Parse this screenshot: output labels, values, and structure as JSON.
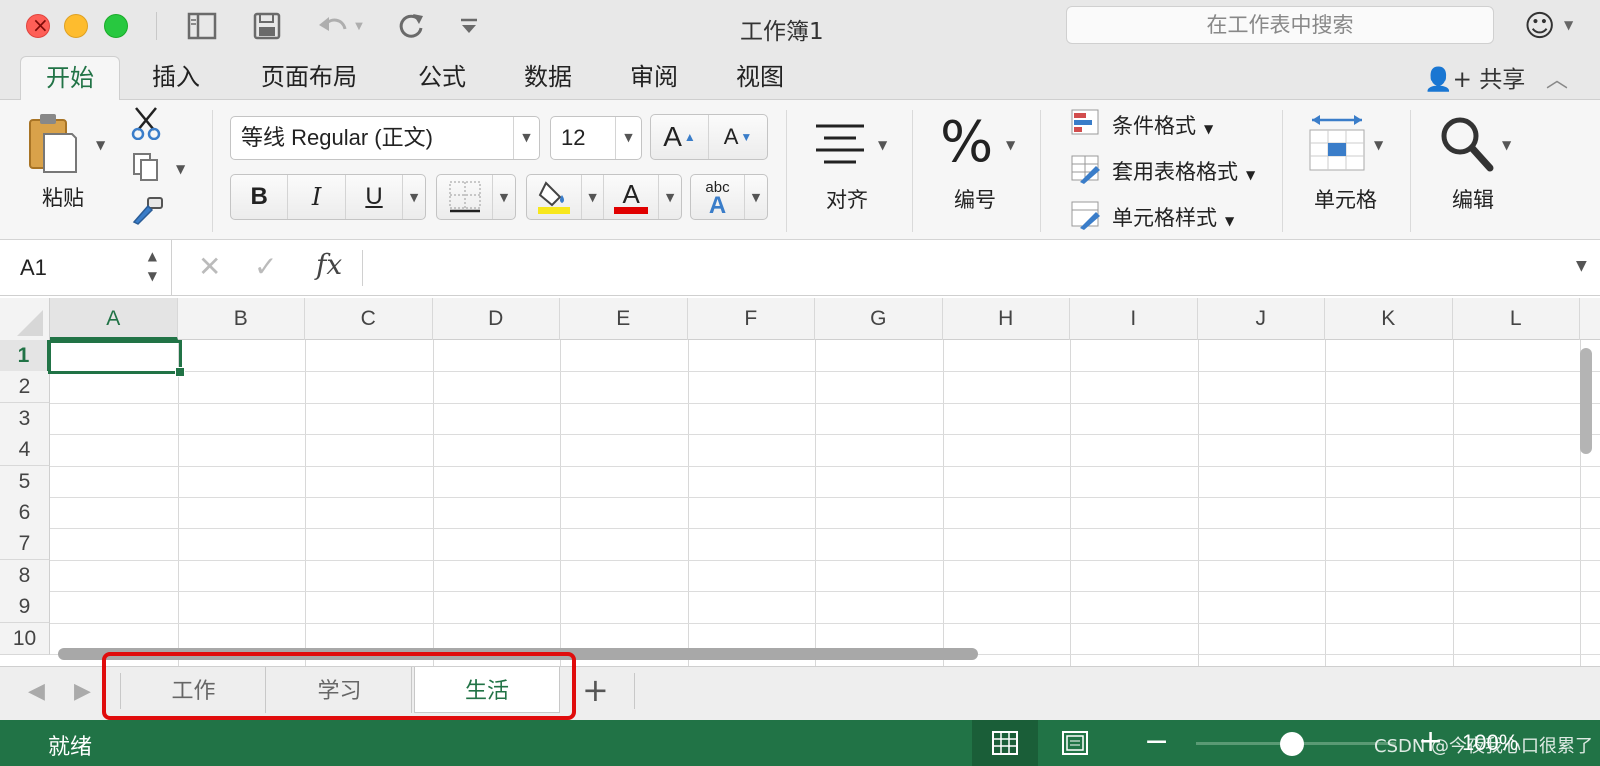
{
  "window": {
    "title": "工作簿1"
  },
  "search": {
    "placeholder": "在工作表中搜索"
  },
  "ribbon_tabs": [
    {
      "label": "开始",
      "active": true
    },
    {
      "label": "插入"
    },
    {
      "label": "页面布局"
    },
    {
      "label": "公式"
    },
    {
      "label": "数据"
    },
    {
      "label": "审阅"
    },
    {
      "label": "视图"
    }
  ],
  "share_label": "共享",
  "clipboard": {
    "paste_label": "粘贴"
  },
  "font": {
    "name": "等线 Regular (正文)",
    "size": "12",
    "bold": "B",
    "italic": "I",
    "underline": "U",
    "grow": "A",
    "shrink": "A",
    "font_color_glyph": "A",
    "phonetic_top": "abc",
    "phonetic_bottom": "A"
  },
  "groups": {
    "align": "对齐",
    "number": "编号",
    "number_glyph": "%",
    "conditional_format": "条件格式",
    "table_format": "套用表格格式",
    "cell_styles": "单元格样式",
    "cells": "单元格",
    "edit": "编辑"
  },
  "formula_bar": {
    "name_box": "A1",
    "fx_label": "fx",
    "content": ""
  },
  "grid": {
    "columns": [
      "A",
      "B",
      "C",
      "D",
      "E",
      "F",
      "G",
      "H",
      "I",
      "J",
      "K",
      "L"
    ],
    "rows": [
      "1",
      "2",
      "3",
      "4",
      "5",
      "6",
      "7",
      "8",
      "9",
      "10"
    ],
    "active_cell": "A1"
  },
  "sheets": [
    {
      "label": "工作"
    },
    {
      "label": "学习"
    },
    {
      "label": "生活",
      "active": true
    }
  ],
  "add_sheet_label": "+",
  "status": {
    "text": "就绪",
    "zoom": "100%",
    "watermark": "CSDN @今夜我心口很累了"
  },
  "colors": {
    "accent": "#217346",
    "highlight": "#e00c0c"
  }
}
